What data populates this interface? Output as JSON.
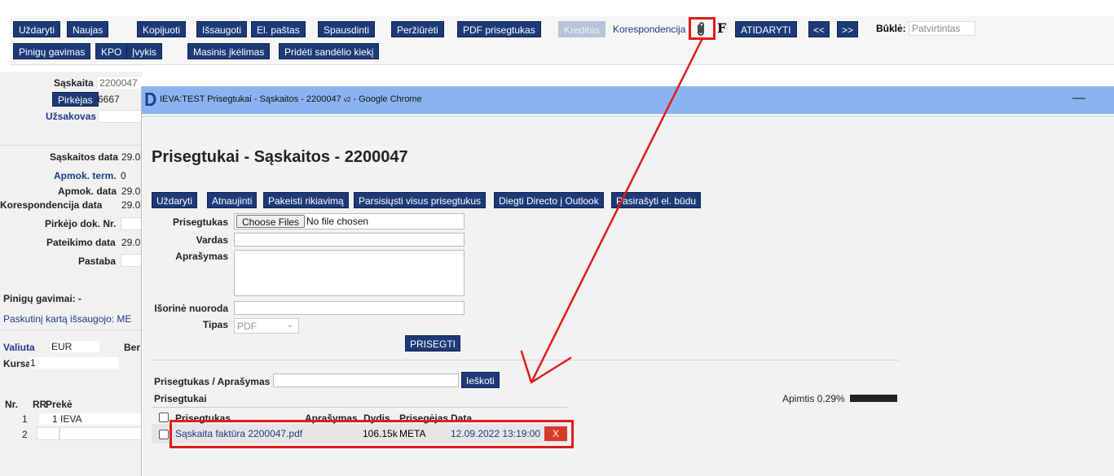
{
  "toolbar": {
    "row1": [
      "Uždaryti",
      "Naujas",
      "Kopijuoti",
      "Išsaugoti",
      "El. paštas",
      "Spausdinti",
      "Peržiūrėti",
      "PDF prisegtukas",
      "Kreditas"
    ],
    "korespondencija": "Korespondencija",
    "f_label": "F",
    "atidaryti": "ATIDARYTI",
    "prev": "<<",
    "next": ">>",
    "bukle_label": "Būklė:",
    "bukle_value": "Patvirtintas",
    "row2": [
      "Pinigų gavimas",
      "KPO",
      "Įvykis",
      "Masinis įkėlimas",
      "Pridėti sandėlio kiekį"
    ]
  },
  "form": {
    "saskaita_label": "Sąskaita",
    "saskaita_value": "2200047",
    "pirkejas_label": "Pirkėjas",
    "pirkejas_value": "6667",
    "uzsakovas_label": "Užsakovas",
    "saskaitos_data_label": "Sąskaitos data",
    "saskaitos_data_value": "29.0",
    "apmok_term_label": "Apmok. term.",
    "apmok_term_value": "0",
    "apmok_data_label": "Apmok. data",
    "apmok_data_value": "29.0",
    "koresp_data_label": "Korespondencija data",
    "koresp_data_value": "29.0",
    "pirkejo_dok_label": "Pirkėjo dok. Nr.",
    "pateikimo_data_label": "Pateikimo data",
    "pateikimo_data_value": "29.0",
    "pastaba_label": "Pastaba",
    "pinigu_gavimai": "Pinigų gavimai: -",
    "paskutini": "Paskutinį kartą išsaugojo: ME",
    "valiuta_label": "Valiuta",
    "valiuta_value": "EUR",
    "ber": "Ber",
    "kursas_label": "Kursas",
    "kursas_value": "1",
    "rows_head_nr": "Nr.",
    "rows_head_rr": "RR",
    "rows_head_preke": "Prekė",
    "row1_nr": "1",
    "row1_rr": "1",
    "row1_preke": "IEVA",
    "row2_nr": "2"
  },
  "popup": {
    "window_title": "IEVA:TEST Prisegtukai - Sąskaitos - 2200047",
    "window_title_sub": "v2",
    "window_title_suffix": "- Google Chrome",
    "minimize": "—",
    "heading": "Prisegtukai - Sąskaitos - 2200047",
    "buttons": [
      "Uždaryti",
      "Atnaujinti",
      "Pakeisti rikiavimą",
      "Parsisiųsti visus prisegtukus",
      "Diegti Directo į Outlook",
      "Pasirašyti el. būdu"
    ],
    "prisegtukas_label": "Prisegtukas",
    "choose_files": "Choose Files",
    "no_file": "No file chosen",
    "vardas_label": "Vardas",
    "aprasymas_label": "Aprašymas",
    "isorine_label": "Išorinė nuoroda",
    "tipas_label": "Tipas",
    "tipas_value": "PDF",
    "prisegti": "PRISEGTI",
    "search_label": "Prisegtukas / Aprašymas",
    "ieskoti": "Ieškoti",
    "list_title": "Prisegtukai",
    "apimtis_label": "Apimtis 0.29%",
    "apimtis_fraction": 0.0029,
    "col_prisegtukas": "Prisegtukas",
    "col_aprasymas": "Aprašymas",
    "col_dydis": "Dydis",
    "col_prisegejas": "Prisegėjas",
    "col_data": "Data",
    "file_name": "Sąskaita faktūra 2200047.pdf",
    "file_size": "106.15k",
    "file_owner": "META",
    "file_date": "12.09.2022 13:19:00",
    "delete_label": "X"
  },
  "colors": {
    "button": "#1c3a78",
    "titlebar": "#8ab4f0",
    "highlight": "#e01b1b",
    "link": "#1c3a8a"
  }
}
